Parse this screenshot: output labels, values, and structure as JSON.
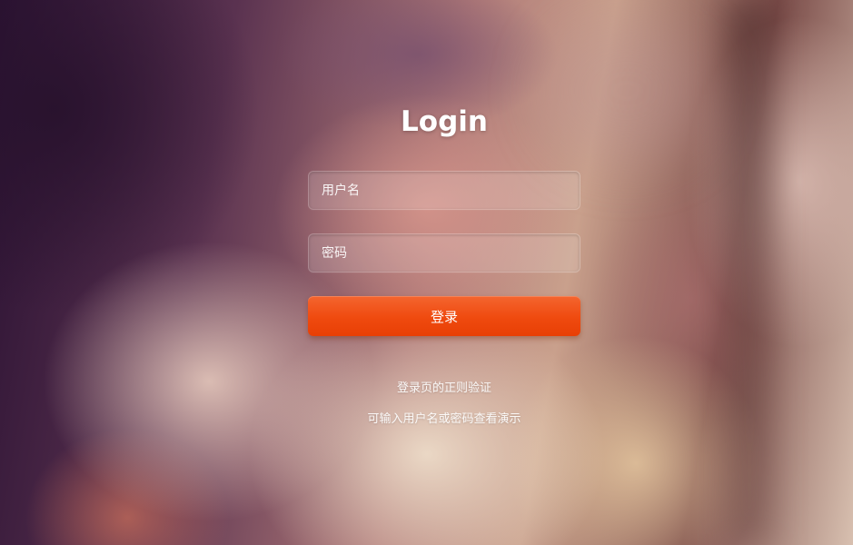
{
  "login": {
    "title": "Login",
    "username_placeholder": "用户名",
    "password_placeholder": "密码",
    "submit_label": "登录",
    "tips": [
      "登录页的正则验证",
      "可输入用户名或密码查看演示"
    ]
  },
  "colors": {
    "button": "#ef4a0f",
    "text": "#ffffff"
  }
}
